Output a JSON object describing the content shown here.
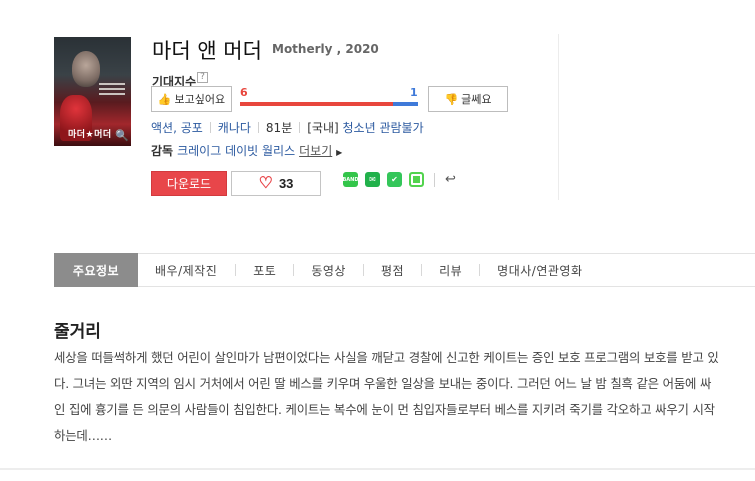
{
  "movie": {
    "title": "마더 앤 머더",
    "original_title": "Motherly , 2020",
    "poster_title": "마더★머더"
  },
  "expectation": {
    "label": "기대지수",
    "help": "?",
    "want_label": "보고싶어요",
    "meh_label": "글쎄요",
    "want_count": "6",
    "meh_count": "1",
    "want_ratio": 0.857
  },
  "meta": {
    "genre": "액션, 공포",
    "country": "캐나다",
    "runtime": "81분",
    "rating_prefix": "[국내]",
    "rating": "청소년 관람불가"
  },
  "director": {
    "label": "감독",
    "names": "크레이그 데이빗 월리스",
    "more": "더보기"
  },
  "actions": {
    "download": "다운로드",
    "likes": "33"
  },
  "share": {
    "icons": [
      "band-icon",
      "line-icon",
      "kakaostory-icon",
      "copy-icon",
      "share-icon"
    ],
    "band": "BAND"
  },
  "tabs": [
    "주요정보",
    "배우/제작진",
    "포토",
    "동영상",
    "평점",
    "리뷰",
    "명대사/연관영화"
  ],
  "plot": {
    "heading": "줄거리",
    "text": "세상을 떠들썩하게 했던 어린이 살인마가 남편이었다는 사실을 깨닫고 경찰에 신고한 케이트는 증인 보호 프로그램의 보호를 받고 있다. 그녀는 외딴 지역의 임시 거처에서 어린 딸 베스를 키우며 우울한 일상을 보내는 중이다. 그러던 어느 날 밤 칠흑 같은 어둠에 싸인 집에 흉기를 든 의문의 사람들이 침입한다. 케이트는 복수에 눈이 먼 침입자들로부터 베스를 지키려 죽기를 각오하고 싸우기 시작하는데……"
  },
  "colors": {
    "accent_red": "#e8464a",
    "accent_blue": "#3f7ad9",
    "link": "#2c5aa0",
    "tab_active": "#8c8c8c"
  }
}
